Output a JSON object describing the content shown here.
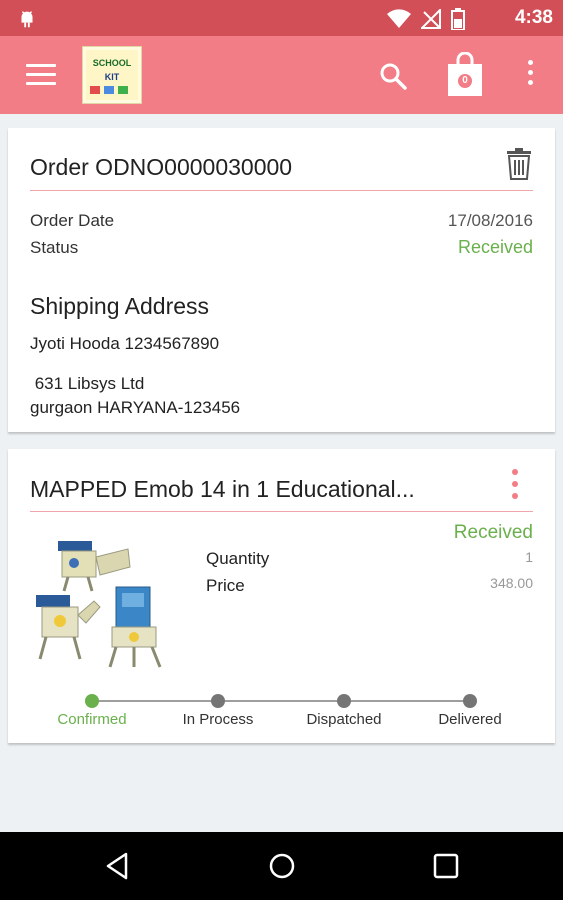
{
  "status_bar": {
    "time": "4:38",
    "icons": [
      "wifi-icon",
      "no-signal-icon",
      "battery-icon"
    ]
  },
  "app_bar": {
    "logo_text": "SCHOOL KIT",
    "cart_count": "0",
    "icons": [
      "menu-icon",
      "search-icon",
      "shopping-bag-icon",
      "more-vert-icon"
    ]
  },
  "order": {
    "title": "Order ODNO0000030000",
    "order_date_label": "Order Date",
    "order_date_value": "17/08/2016",
    "status_label": "Status",
    "status_value": "Received",
    "shipping_title": "Shipping Address",
    "shipping_name_phone": "Jyoti Hooda  1234567890",
    "address_line1": " 631 Libsys Ltd",
    "address_line2": "gurgaon HARYANA-123456"
  },
  "item": {
    "title": "MAPPED Emob 14 in 1 Educational...",
    "status": "Received",
    "quantity_label": "Quantity",
    "quantity_value": "1",
    "price_label": "Price",
    "price_value": "348.00",
    "progress": {
      "steps": [
        "Confirmed",
        "In Process",
        "Dispatched",
        "Delivered"
      ],
      "current_index": 0
    }
  },
  "colors": {
    "status_bar": "#d24f57",
    "app_bar": "#f27d86",
    "accent_green": "#6ab04c",
    "divider": "#f0a5ab",
    "more_dots": "#f27d86"
  }
}
